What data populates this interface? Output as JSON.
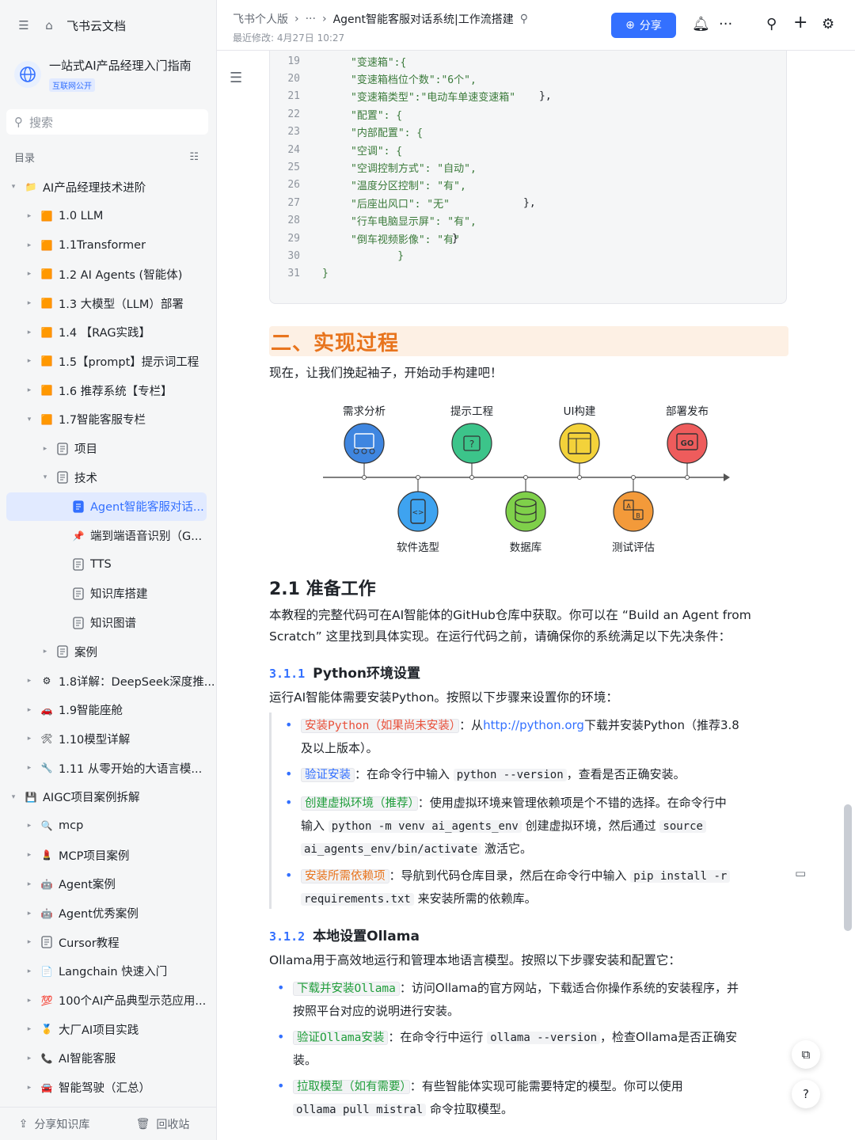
{
  "sidebar": {
    "app_title": "飞书云文档",
    "kb_title": "一站式AI产品经理入门指南",
    "kb_badge": "互联网公开",
    "search_placeholder": "搜索",
    "toc_label": "目录",
    "items": [
      {
        "label": "AI产品经理技术进阶",
        "level": 0,
        "arrow": "▾",
        "icon": "📁",
        "active": false
      },
      {
        "label": "1.0 LLM",
        "level": 1,
        "arrow": "▸",
        "icon": "🟧",
        "active": false
      },
      {
        "label": "1.1Transformer",
        "level": 1,
        "arrow": "▸",
        "icon": "🟧",
        "active": false
      },
      {
        "label": "1.2 AI Agents (智能体)",
        "level": 1,
        "arrow": "▸",
        "icon": "🟧",
        "active": false
      },
      {
        "label": "1.3 大模型（LLM）部署",
        "level": 1,
        "arrow": "▸",
        "icon": "🟧",
        "active": false
      },
      {
        "label": "1.4 【RAG实践】",
        "level": 1,
        "arrow": "▸",
        "icon": "🟧",
        "active": false
      },
      {
        "label": "1.5【prompt】提示词工程",
        "level": 1,
        "arrow": "▸",
        "icon": "🟧",
        "active": false
      },
      {
        "label": "1.6 推荐系统【专栏】",
        "level": 1,
        "arrow": "▸",
        "icon": "🟧",
        "active": false
      },
      {
        "label": "1.7智能客服专栏",
        "level": 1,
        "arrow": "▾",
        "icon": "🟧",
        "active": false
      },
      {
        "label": "项目",
        "level": 2,
        "arrow": "▸",
        "icon": "doc",
        "active": false
      },
      {
        "label": "技术",
        "level": 2,
        "arrow": "▾",
        "icon": "doc",
        "active": false
      },
      {
        "label": "Agent智能客服对话...",
        "level": 3,
        "arrow": "",
        "icon": "doc-blue",
        "active": true
      },
      {
        "label": "端到端语音识别（G...",
        "level": 3,
        "arrow": "",
        "icon": "📌",
        "active": false
      },
      {
        "label": "TTS",
        "level": 3,
        "arrow": "",
        "icon": "doc",
        "active": false
      },
      {
        "label": "知识库搭建",
        "level": 3,
        "arrow": "",
        "icon": "doc",
        "active": false
      },
      {
        "label": "知识图谱",
        "level": 3,
        "arrow": "",
        "icon": "doc",
        "active": false
      },
      {
        "label": "案例",
        "level": 2,
        "arrow": "▸",
        "icon": "doc",
        "active": false
      },
      {
        "label": "1.8详解：DeepSeek深度推...",
        "level": 1,
        "arrow": "▸",
        "icon": "⚙",
        "active": false
      },
      {
        "label": "1.9智能座舱",
        "level": 1,
        "arrow": "▸",
        "icon": "🚗",
        "active": false
      },
      {
        "label": "1.10模型详解",
        "level": 1,
        "arrow": "▸",
        "icon": "🛠",
        "active": false
      },
      {
        "label": "1.11 从零开始的大语言模...",
        "level": 1,
        "arrow": "▸",
        "icon": "🔧",
        "active": false
      },
      {
        "label": "AIGC项目案例拆解",
        "level": 0,
        "arrow": "▾",
        "icon": "💾",
        "active": false
      },
      {
        "label": "mcp",
        "level": 1,
        "arrow": "▸",
        "icon": "🔍",
        "active": false
      },
      {
        "label": "MCP项目案例",
        "level": 1,
        "arrow": "▸",
        "icon": "💄",
        "active": false
      },
      {
        "label": "Agent案例",
        "level": 1,
        "arrow": "▸",
        "icon": "🤖",
        "active": false
      },
      {
        "label": "Agent优秀案例",
        "level": 1,
        "arrow": "▸",
        "icon": "🤖",
        "active": false
      },
      {
        "label": "Cursor教程",
        "level": 1,
        "arrow": "▸",
        "icon": "doc",
        "active": false
      },
      {
        "label": "Langchain 快速入门",
        "level": 1,
        "arrow": "▸",
        "icon": "📄",
        "active": false
      },
      {
        "label": "100个AI产品典型示范应用...",
        "level": 1,
        "arrow": "▸",
        "icon": "💯",
        "active": false
      },
      {
        "label": "大厂AI项目实践",
        "level": 1,
        "arrow": "▸",
        "icon": "🥇",
        "active": false
      },
      {
        "label": "AI智能客服",
        "level": 1,
        "arrow": "▸",
        "icon": "📞",
        "active": false
      },
      {
        "label": "智能驾驶（汇总）",
        "level": 1,
        "arrow": "▸",
        "icon": "🚘",
        "active": false
      }
    ],
    "footer": {
      "share": "分享知识库",
      "recycle": "回收站"
    }
  },
  "header": {
    "crumb_space": "飞书个人版",
    "crumb_more": "···",
    "crumb_doc": "Agent智能客服对话系统|工作流搭建",
    "modified": "最近修改: 4月27日 10:27",
    "share_label": "分享"
  },
  "code": {
    "lines": [
      {
        "n": "19",
        "text": "\"变速箱\":{",
        "tail": ""
      },
      {
        "n": "20",
        "text": "\"变速箱档位个数\":\"6个\",",
        "tail": ""
      },
      {
        "n": "21",
        "text": "\"变速箱类型\":\"电动车单速变速箱\"",
        "tail": "},"
      },
      {
        "n": "22",
        "text": "\"配置\": {",
        "tail": ""
      },
      {
        "n": "23",
        "text": "\"内部配置\": {",
        "tail": ""
      },
      {
        "n": "24",
        "text": "\"空调\": {",
        "tail": ""
      },
      {
        "n": "25",
        "text": "\"空调控制方式\": \"自动\",",
        "tail": ""
      },
      {
        "n": "26",
        "text": "\"温度分区控制\": \"有\",",
        "tail": ""
      },
      {
        "n": "27",
        "text": "\"后座出风口\": \"无\"",
        "tail": "},"
      },
      {
        "n": "28",
        "text": "\"行车电脑显示屏\": \"有\",",
        "tail": ""
      },
      {
        "n": "29",
        "text": "\"倒车视频影像\": \"有\"",
        "tail": "}"
      },
      {
        "n": "30",
        "text": "    }",
        "tail": ""
      },
      {
        "n": "31",
        "text": "}",
        "tail": ""
      }
    ]
  },
  "content": {
    "section_title": "二、实现过程",
    "intro": "现在，让我们挽起袖子，开始动手构建吧！",
    "flow": {
      "top": [
        "需求分析",
        "提示工程",
        "UI构建",
        "部署发布"
      ],
      "bottom": [
        "软件选型",
        "数据库",
        "测试评估"
      ],
      "colors": {
        "blue": "#3f86e0",
        "green": "#3cc48a",
        "yellow": "#f3d23a",
        "red": "#ee5c5c",
        "lightblue": "#3ea3f0",
        "lime": "#7fd04a",
        "orange": "#f39a3a"
      }
    },
    "h21": "2.1 准备工作",
    "p21": "本教程的完整代码可在AI智能体的GitHub仓库中获取。你可以在 “Build an Agent from Scratch” 这里找到具体实现。在运行代码之前，请确保你的系统满足以下先决条件：",
    "h311_num": "3.1.1",
    "h311_title": "Python环境设置",
    "p311": "运行AI智能体需要安装Python。按照以下步骤来设置你的环境：",
    "py_items": {
      "i1_tag": "安装Python（如果尚未安装）",
      "i1_a": "：从",
      "i1_link": "http://python.org",
      "i1_b": "下载并安装Python（推荐3.8",
      "i1_c": "及以上版本）。",
      "i2_tag": "验证安装",
      "i2_a": "：在命令行中输入",
      "i2_code": "python --version",
      "i2_b": "，查看是否正确安装。",
      "i3_tag": "创建虚拟环境（推荐）",
      "i3_a": "：使用虚拟环境来管理依赖项是个不错的选择。在命令行中",
      "i3_b": "输入",
      "i3_code1": "python -m venv ai_agents_env",
      "i3_c": "创建虚拟环境，然后通过",
      "i3_code2": "source",
      "i3_code3": "ai_agents_env/bin/activate",
      "i3_d": "激活它。",
      "i4_tag": "安装所需依赖项",
      "i4_a": "：导航到代码仓库目录，然后在命令行中输入",
      "i4_code1": "pip install -r",
      "i4_code2": "requirements.txt",
      "i4_b": "来安装所需的依赖库。"
    },
    "h312_num": "3.1.2",
    "h312_title": "本地设置Ollama",
    "p312": "Ollama用于高效地运行和管理本地语言模型。按照以下步骤安装和配置它：",
    "ol_items": {
      "i1_tag": "下载并安装Ollama",
      "i1_a": "：访问Ollama的官方网站，下载适合你操作系统的安装程序，并",
      "i1_b": "按照平台对应的说明进行安装。",
      "i2_tag": "验证Ollama安装",
      "i2_a": "：在命令行中运行",
      "i2_code": "ollama --version",
      "i2_b": "，检查Ollama是否正确安",
      "i2_c": "装。",
      "i3_tag": "拉取模型（如有需要）",
      "i3_a": "：有些智能体实现可能需要特定的模型。你可以使用",
      "i3_code": "ollama pull mistral",
      "i3_b": "命令拉取模型。"
    }
  }
}
